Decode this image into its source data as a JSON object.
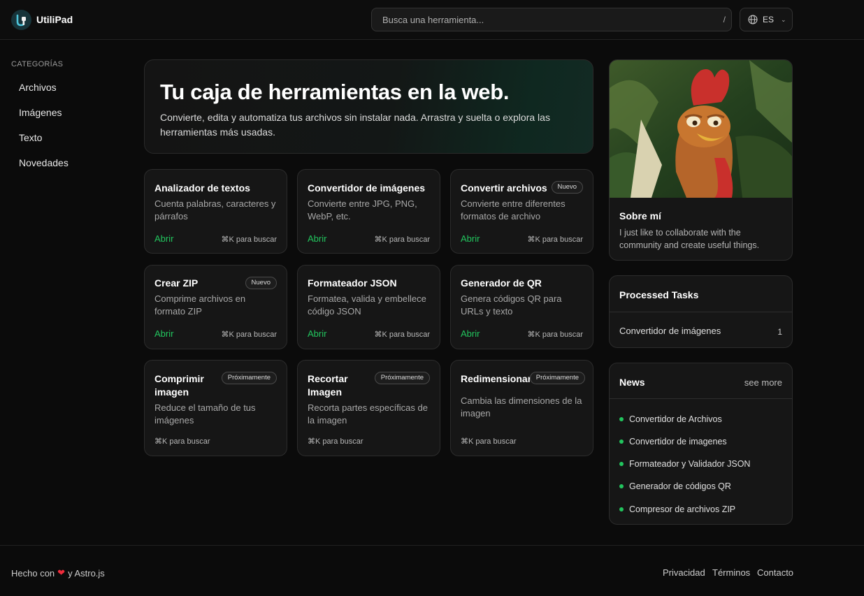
{
  "header": {
    "brand": "UtiliPad",
    "search_placeholder": "Busca una herramienta...",
    "search_shortcut": "/",
    "language": "ES"
  },
  "sidebar": {
    "title": "CATEGORÍAS",
    "items": [
      "Archivos",
      "Imágenes",
      "Texto",
      "Novedades"
    ]
  },
  "hero": {
    "title": "Tu caja de herramientas en la web.",
    "description": "Convierte, edita y automatiza tus archivos sin instalar nada. Arrastra y suelta o explora las herramientas más usadas."
  },
  "tools": [
    {
      "title": "Analizador de textos",
      "description": "Cuenta palabras, caracteres y párrafos",
      "open": "Abrir",
      "shortcut": "⌘K para buscar",
      "badge": ""
    },
    {
      "title": "Convertidor de imágenes",
      "description": "Convierte entre JPG, PNG, WebP, etc.",
      "open": "Abrir",
      "shortcut": "⌘K para buscar",
      "badge": ""
    },
    {
      "title": "Convertir archivos",
      "description": "Convierte entre diferentes formatos de archivo",
      "open": "Abrir",
      "shortcut": "⌘K para buscar",
      "badge": "Nuevo"
    },
    {
      "title": "Crear ZIP",
      "description": "Comprime archivos en formato ZIP",
      "open": "Abrir",
      "shortcut": "⌘K para buscar",
      "badge": "Nuevo"
    },
    {
      "title": "Formateador JSON",
      "description": "Formatea, valida y embellece código JSON",
      "open": "Abrir",
      "shortcut": "⌘K para buscar",
      "badge": ""
    },
    {
      "title": "Generador de QR",
      "description": "Genera códigos QR para URLs y texto",
      "open": "Abrir",
      "shortcut": "⌘K para buscar",
      "badge": ""
    },
    {
      "title": "Comprimir imagen",
      "description": "Reduce el tamaño de tus imágenes",
      "open": "",
      "shortcut": "⌘K para buscar",
      "badge": "Próximamente"
    },
    {
      "title": "Recortar Imagen",
      "description": "Recorta partes específicas de la imagen",
      "open": "",
      "shortcut": "⌘K para buscar",
      "badge": "Próximamente"
    },
    {
      "title": "Redimensionar",
      "description": "Cambia las dimensiones de la imagen",
      "open": "",
      "shortcut": "⌘K para buscar",
      "badge": "Próximamente"
    }
  ],
  "about": {
    "title": "Sobre mí",
    "description": "I just like to collaborate with the community and create useful things."
  },
  "tasks": {
    "title": "Processed Tasks",
    "items": [
      {
        "name": "Convertidor de imágenes",
        "count": "1"
      }
    ]
  },
  "news": {
    "title": "News",
    "see_more": "see more",
    "items": [
      "Convertidor de Archivos",
      "Convertidor de imagenes",
      "Formateador y Validador JSON",
      "Generador de códigos QR",
      "Compresor de archivos ZIP"
    ]
  },
  "footer": {
    "made_with": "Hecho con",
    "made_with_suffix": "y Astro.js",
    "links": [
      "Privacidad",
      "Términos",
      "Contacto"
    ]
  },
  "colors": {
    "accent": "#22c55e",
    "background": "#0b0b0b",
    "card": "#161616",
    "heart": "#ef2b3b"
  }
}
